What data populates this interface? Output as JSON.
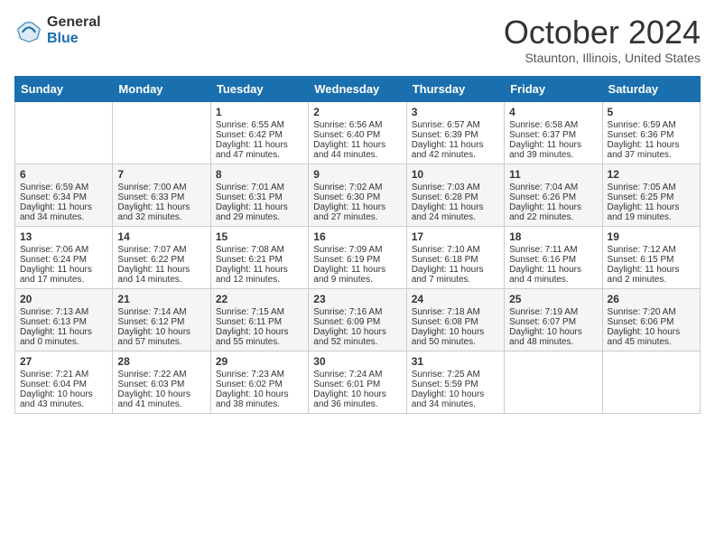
{
  "logo": {
    "general": "General",
    "blue": "Blue"
  },
  "header": {
    "month": "October 2024",
    "location": "Staunton, Illinois, United States"
  },
  "weekdays": [
    "Sunday",
    "Monday",
    "Tuesday",
    "Wednesday",
    "Thursday",
    "Friday",
    "Saturday"
  ],
  "weeks": [
    [
      {
        "day": "",
        "sunrise": "",
        "sunset": "",
        "daylight": ""
      },
      {
        "day": "",
        "sunrise": "",
        "sunset": "",
        "daylight": ""
      },
      {
        "day": "1",
        "sunrise": "Sunrise: 6:55 AM",
        "sunset": "Sunset: 6:42 PM",
        "daylight": "Daylight: 11 hours and 47 minutes."
      },
      {
        "day": "2",
        "sunrise": "Sunrise: 6:56 AM",
        "sunset": "Sunset: 6:40 PM",
        "daylight": "Daylight: 11 hours and 44 minutes."
      },
      {
        "day": "3",
        "sunrise": "Sunrise: 6:57 AM",
        "sunset": "Sunset: 6:39 PM",
        "daylight": "Daylight: 11 hours and 42 minutes."
      },
      {
        "day": "4",
        "sunrise": "Sunrise: 6:58 AM",
        "sunset": "Sunset: 6:37 PM",
        "daylight": "Daylight: 11 hours and 39 minutes."
      },
      {
        "day": "5",
        "sunrise": "Sunrise: 6:59 AM",
        "sunset": "Sunset: 6:36 PM",
        "daylight": "Daylight: 11 hours and 37 minutes."
      }
    ],
    [
      {
        "day": "6",
        "sunrise": "Sunrise: 6:59 AM",
        "sunset": "Sunset: 6:34 PM",
        "daylight": "Daylight: 11 hours and 34 minutes."
      },
      {
        "day": "7",
        "sunrise": "Sunrise: 7:00 AM",
        "sunset": "Sunset: 6:33 PM",
        "daylight": "Daylight: 11 hours and 32 minutes."
      },
      {
        "day": "8",
        "sunrise": "Sunrise: 7:01 AM",
        "sunset": "Sunset: 6:31 PM",
        "daylight": "Daylight: 11 hours and 29 minutes."
      },
      {
        "day": "9",
        "sunrise": "Sunrise: 7:02 AM",
        "sunset": "Sunset: 6:30 PM",
        "daylight": "Daylight: 11 hours and 27 minutes."
      },
      {
        "day": "10",
        "sunrise": "Sunrise: 7:03 AM",
        "sunset": "Sunset: 6:28 PM",
        "daylight": "Daylight: 11 hours and 24 minutes."
      },
      {
        "day": "11",
        "sunrise": "Sunrise: 7:04 AM",
        "sunset": "Sunset: 6:26 PM",
        "daylight": "Daylight: 11 hours and 22 minutes."
      },
      {
        "day": "12",
        "sunrise": "Sunrise: 7:05 AM",
        "sunset": "Sunset: 6:25 PM",
        "daylight": "Daylight: 11 hours and 19 minutes."
      }
    ],
    [
      {
        "day": "13",
        "sunrise": "Sunrise: 7:06 AM",
        "sunset": "Sunset: 6:24 PM",
        "daylight": "Daylight: 11 hours and 17 minutes."
      },
      {
        "day": "14",
        "sunrise": "Sunrise: 7:07 AM",
        "sunset": "Sunset: 6:22 PM",
        "daylight": "Daylight: 11 hours and 14 minutes."
      },
      {
        "day": "15",
        "sunrise": "Sunrise: 7:08 AM",
        "sunset": "Sunset: 6:21 PM",
        "daylight": "Daylight: 11 hours and 12 minutes."
      },
      {
        "day": "16",
        "sunrise": "Sunrise: 7:09 AM",
        "sunset": "Sunset: 6:19 PM",
        "daylight": "Daylight: 11 hours and 9 minutes."
      },
      {
        "day": "17",
        "sunrise": "Sunrise: 7:10 AM",
        "sunset": "Sunset: 6:18 PM",
        "daylight": "Daylight: 11 hours and 7 minutes."
      },
      {
        "day": "18",
        "sunrise": "Sunrise: 7:11 AM",
        "sunset": "Sunset: 6:16 PM",
        "daylight": "Daylight: 11 hours and 4 minutes."
      },
      {
        "day": "19",
        "sunrise": "Sunrise: 7:12 AM",
        "sunset": "Sunset: 6:15 PM",
        "daylight": "Daylight: 11 hours and 2 minutes."
      }
    ],
    [
      {
        "day": "20",
        "sunrise": "Sunrise: 7:13 AM",
        "sunset": "Sunset: 6:13 PM",
        "daylight": "Daylight: 11 hours and 0 minutes."
      },
      {
        "day": "21",
        "sunrise": "Sunrise: 7:14 AM",
        "sunset": "Sunset: 6:12 PM",
        "daylight": "Daylight: 10 hours and 57 minutes."
      },
      {
        "day": "22",
        "sunrise": "Sunrise: 7:15 AM",
        "sunset": "Sunset: 6:11 PM",
        "daylight": "Daylight: 10 hours and 55 minutes."
      },
      {
        "day": "23",
        "sunrise": "Sunrise: 7:16 AM",
        "sunset": "Sunset: 6:09 PM",
        "daylight": "Daylight: 10 hours and 52 minutes."
      },
      {
        "day": "24",
        "sunrise": "Sunrise: 7:18 AM",
        "sunset": "Sunset: 6:08 PM",
        "daylight": "Daylight: 10 hours and 50 minutes."
      },
      {
        "day": "25",
        "sunrise": "Sunrise: 7:19 AM",
        "sunset": "Sunset: 6:07 PM",
        "daylight": "Daylight: 10 hours and 48 minutes."
      },
      {
        "day": "26",
        "sunrise": "Sunrise: 7:20 AM",
        "sunset": "Sunset: 6:06 PM",
        "daylight": "Daylight: 10 hours and 45 minutes."
      }
    ],
    [
      {
        "day": "27",
        "sunrise": "Sunrise: 7:21 AM",
        "sunset": "Sunset: 6:04 PM",
        "daylight": "Daylight: 10 hours and 43 minutes."
      },
      {
        "day": "28",
        "sunrise": "Sunrise: 7:22 AM",
        "sunset": "Sunset: 6:03 PM",
        "daylight": "Daylight: 10 hours and 41 minutes."
      },
      {
        "day": "29",
        "sunrise": "Sunrise: 7:23 AM",
        "sunset": "Sunset: 6:02 PM",
        "daylight": "Daylight: 10 hours and 38 minutes."
      },
      {
        "day": "30",
        "sunrise": "Sunrise: 7:24 AM",
        "sunset": "Sunset: 6:01 PM",
        "daylight": "Daylight: 10 hours and 36 minutes."
      },
      {
        "day": "31",
        "sunrise": "Sunrise: 7:25 AM",
        "sunset": "Sunset: 5:59 PM",
        "daylight": "Daylight: 10 hours and 34 minutes."
      },
      {
        "day": "",
        "sunrise": "",
        "sunset": "",
        "daylight": ""
      },
      {
        "day": "",
        "sunrise": "",
        "sunset": "",
        "daylight": ""
      }
    ]
  ]
}
